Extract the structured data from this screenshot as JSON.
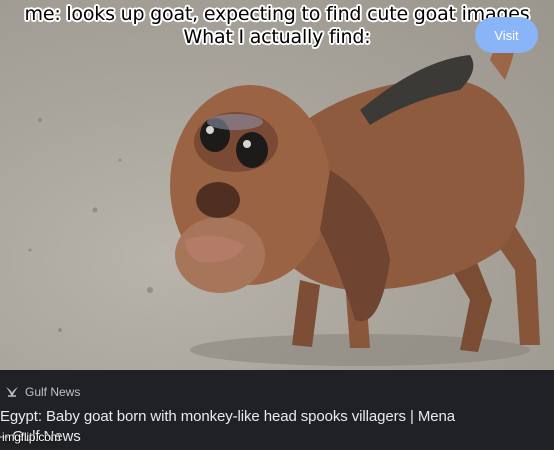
{
  "caption": {
    "line1": "me: looks up goat, expecting to find cute goat images",
    "line2": "What I actually find:"
  },
  "result": {
    "source_icon": "gulf-news-logo-icon",
    "source_name": "Gulf News",
    "headline": "Egypt: Baby goat born with monkey-like head spooks villagers | Mena – Gulf News",
    "visit_label": "Visit"
  },
  "watermark": "imgflip.com",
  "colors": {
    "card_background": "#202124",
    "visit_button": "#8ab4f8",
    "goat_fur": "#8a5a3e"
  }
}
